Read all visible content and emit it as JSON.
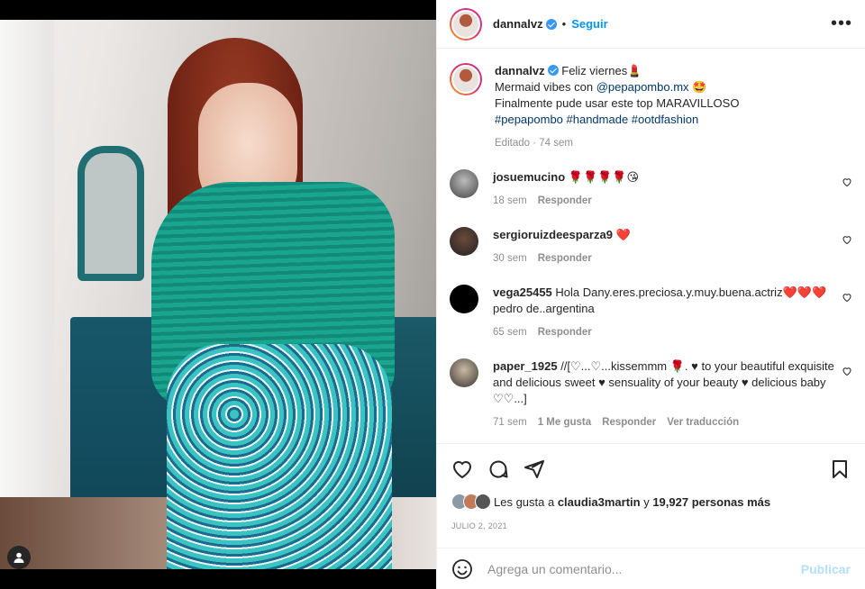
{
  "post": {
    "username": "dannalvz",
    "separator": "•",
    "follow_label": "Seguir",
    "more_label": "•••"
  },
  "caption": {
    "username": "dannalvz",
    "line1": "Feliz viernes💄",
    "line2_prefix": "Mermaid vibes con ",
    "line2_link": "@pepapombo.mx",
    "line2_emoji": "🤩",
    "line3": "Finalmente pude usar este top MARAVILLOSO",
    "hashtags": "#pepapombo #handmade #ootdfashion",
    "meta": "Editado · 74 sem"
  },
  "comments": [
    {
      "user": "josuemucino",
      "text": "🌹🌹🌹🌹😘",
      "time": "18 sem",
      "reply": "Responder"
    },
    {
      "user": "sergioruizdeesparza9",
      "text": "❤️",
      "time": "30 sem",
      "reply": "Responder"
    },
    {
      "user": "vega25455",
      "text": "Hola Dany.eres.preciosa.y.muy.buena.actriz❤️❤️❤️pedro de..argentina",
      "time": "65 sem",
      "reply": "Responder"
    },
    {
      "user": "paper_1925",
      "text": "//[♡...♡...kissemmm 🌹. ♥ to your beautiful exquisite and delicious sweet ♥ sensuality of your beauty ♥ delicious baby ♡♡...]",
      "time": "71 sem",
      "likes": "1 Me gusta",
      "reply": "Responder",
      "translate": "Ver traducción"
    }
  ],
  "likes": {
    "prefix": "Les gusta a ",
    "user": "claudia3martin",
    "mid": " y ",
    "count": "19,927 personas más"
  },
  "date": "JULIO 2, 2021",
  "composer": {
    "placeholder": "Agrega un comentario...",
    "publish_label": "Publicar"
  },
  "colors": {
    "accent": "#0095f6",
    "verified": "#3897f0",
    "heart": "#ed4956",
    "muted": "#8e8e8e"
  }
}
